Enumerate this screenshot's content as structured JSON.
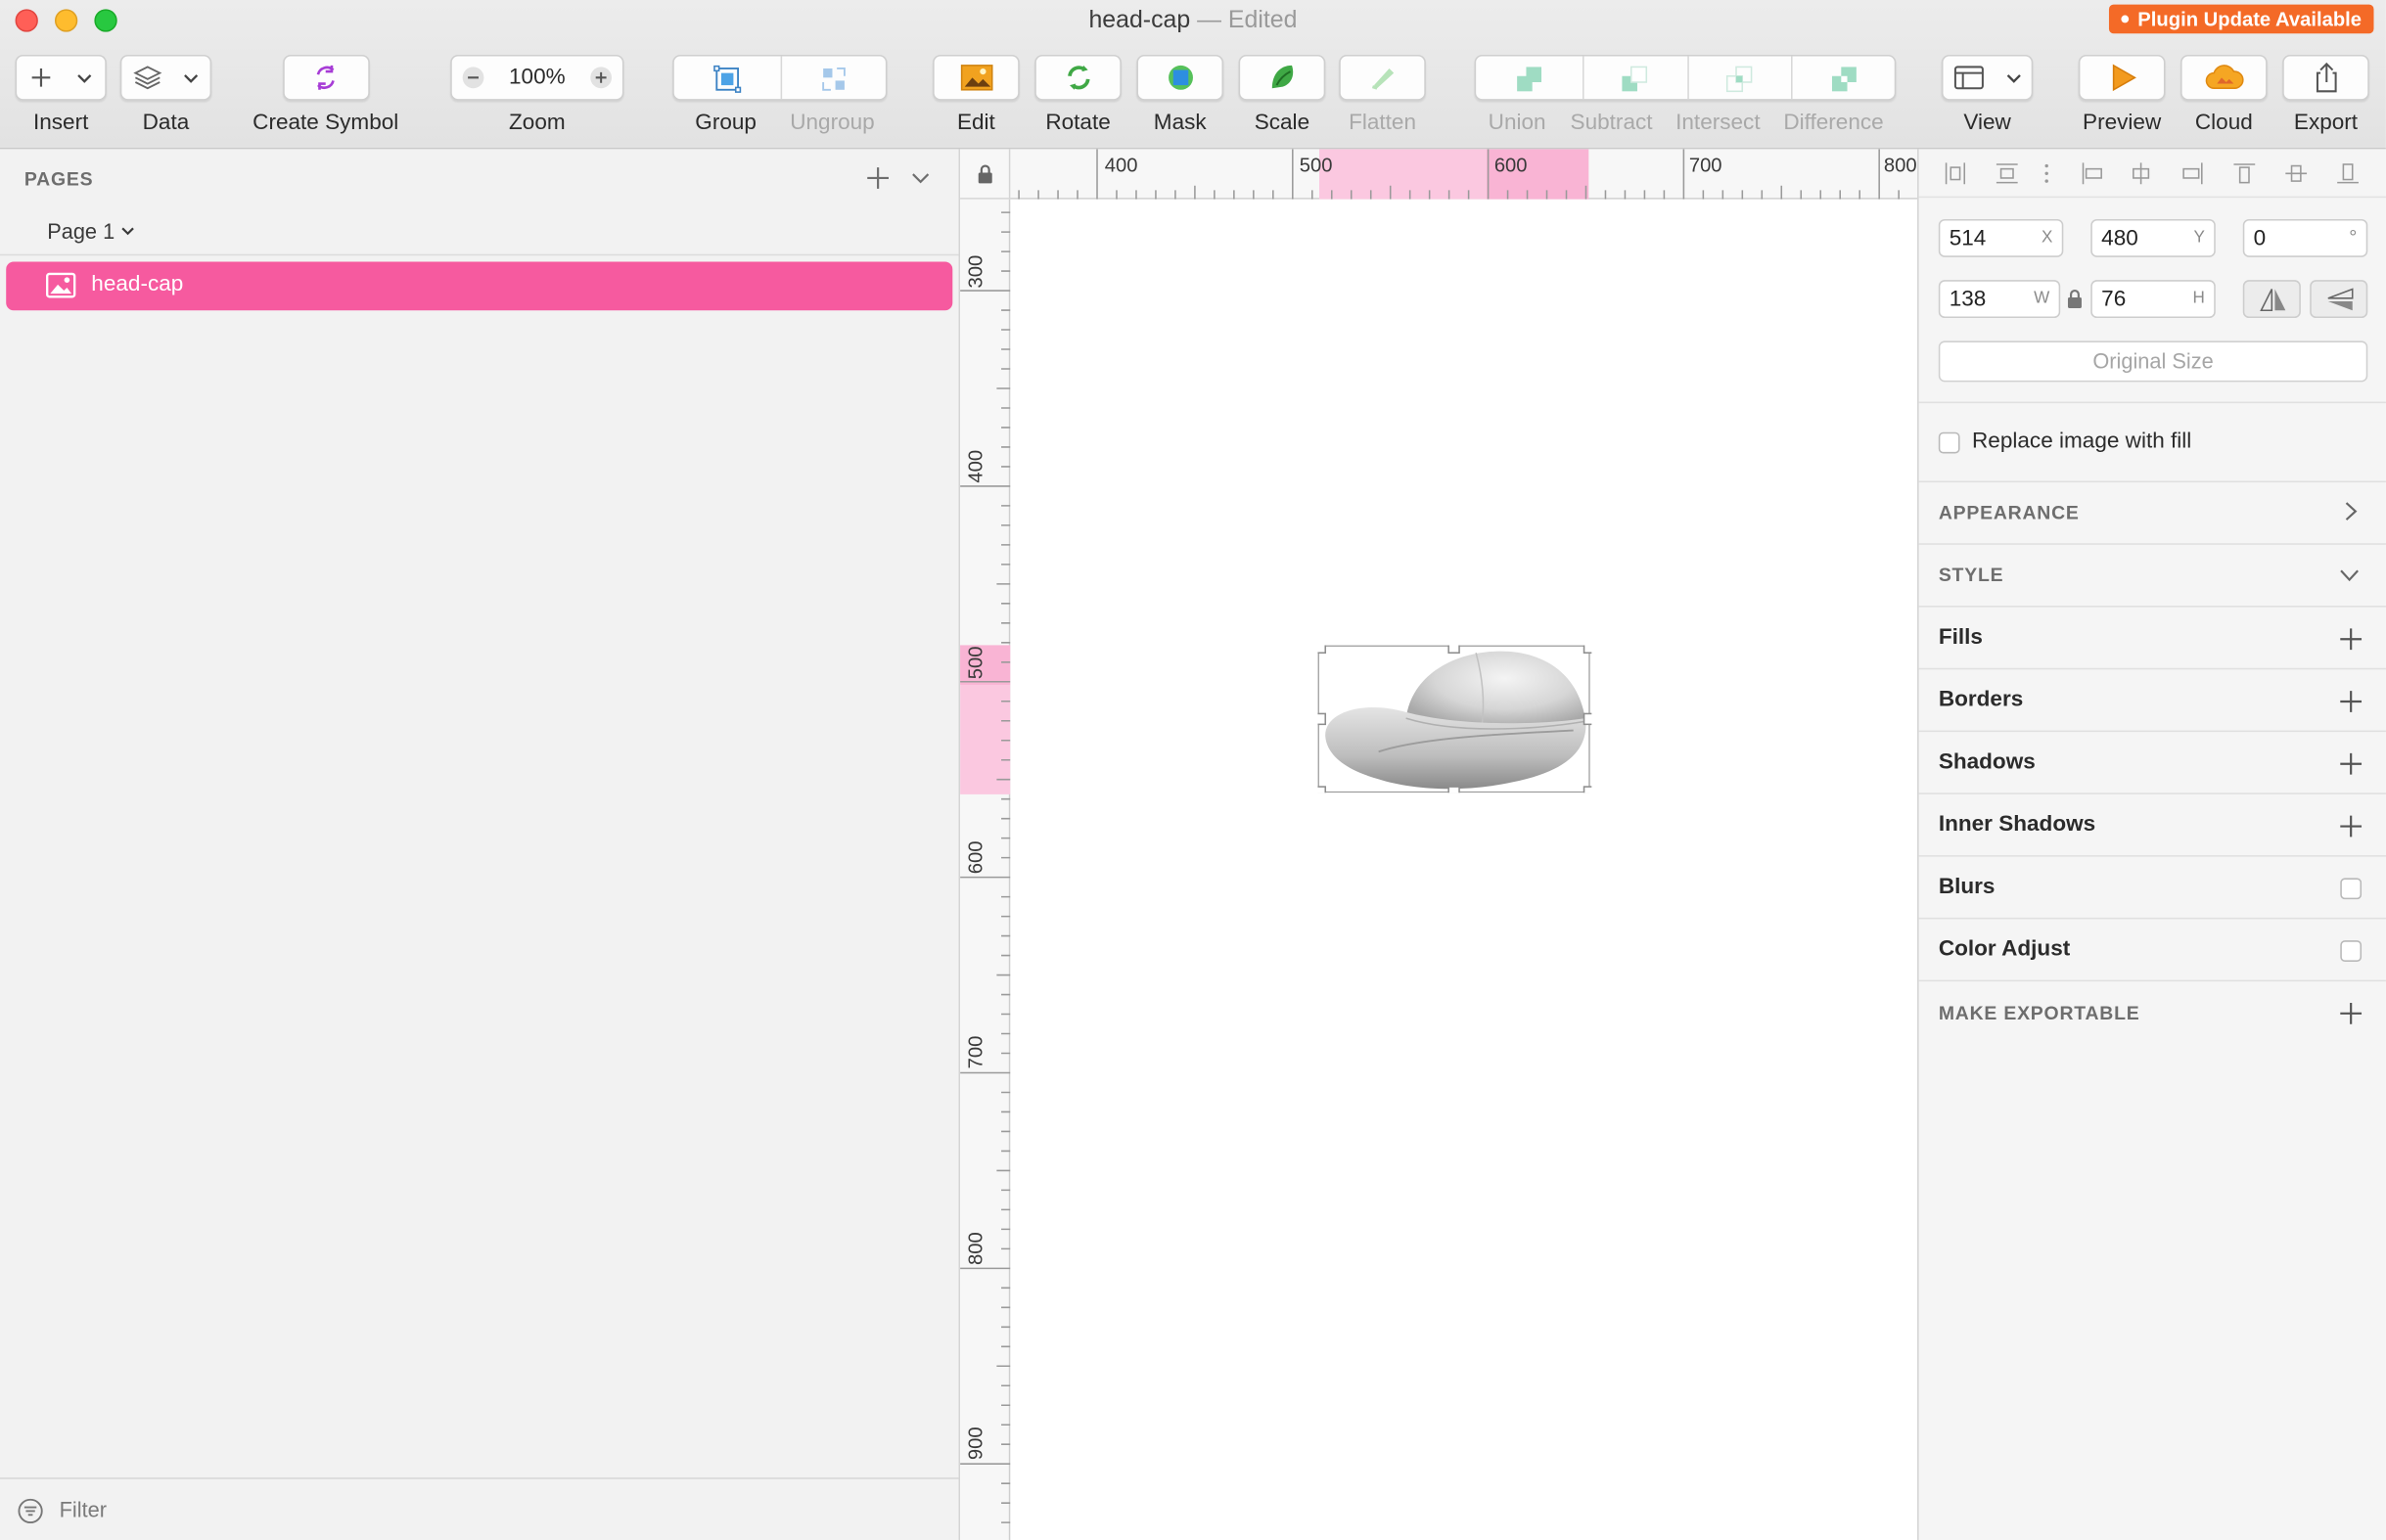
{
  "window": {
    "title": "head-cap",
    "edited": "— Edited",
    "plugin_badge": "Plugin Update Available"
  },
  "toolbar": {
    "insert": "Insert",
    "data": "Data",
    "create_symbol": "Create Symbol",
    "zoom_label": "Zoom",
    "zoom_value": "100%",
    "group": "Group",
    "ungroup": "Ungroup",
    "edit": "Edit",
    "rotate": "Rotate",
    "mask": "Mask",
    "scale": "Scale",
    "flatten": "Flatten",
    "union": "Union",
    "subtract": "Subtract",
    "intersect": "Intersect",
    "difference": "Difference",
    "view": "View",
    "preview": "Preview",
    "cloud": "Cloud",
    "export": "Export"
  },
  "pages_panel": {
    "header": "PAGES",
    "current_page": "Page 1",
    "layers": [
      {
        "name": "head-cap",
        "type": "image",
        "selected": true
      }
    ],
    "filter_placeholder": "Filter"
  },
  "rulers": {
    "horizontal": [
      "400",
      "500",
      "600",
      "700",
      "800"
    ],
    "vertical": [
      "300",
      "400",
      "500",
      "600",
      "700",
      "800",
      "900"
    ]
  },
  "inspector": {
    "x": "514",
    "x_unit": "X",
    "y": "480",
    "y_unit": "Y",
    "rotation": "0",
    "rotation_unit": "°",
    "width": "138",
    "width_unit": "W",
    "height": "76",
    "height_unit": "H",
    "original_size": "Original Size",
    "replace_image": "Replace image with fill",
    "appearance": "APPEARANCE",
    "style": "STYLE",
    "fills": "Fills",
    "borders": "Borders",
    "shadows": "Shadows",
    "inner_shadows": "Inner Shadows",
    "blurs": "Blurs",
    "color_adjust": "Color Adjust",
    "make_exportable": "MAKE EXPORTABLE"
  },
  "colors": {
    "selection": "#f65a9f",
    "ruler_highlight": "#fbc8e0",
    "plugin_badge": "#f46a27",
    "handle": "#8e8e8e"
  },
  "icons": [
    "plus-icon",
    "layers-icon",
    "symbol-icon",
    "group-icon",
    "ungroup-icon",
    "edit-image-icon",
    "rotate-icon",
    "mask-icon",
    "scale-icon",
    "flatten-icon",
    "union-icon",
    "subtract-icon",
    "intersect-icon",
    "difference-icon",
    "view-icon",
    "preview-play-icon",
    "cloud-icon",
    "export-share-icon",
    "lock-icon",
    "image-icon",
    "filter-icon",
    "chevron-down-icon",
    "chevron-right-icon"
  ]
}
